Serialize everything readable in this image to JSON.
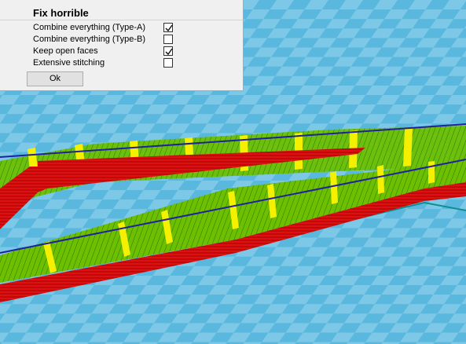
{
  "dialog": {
    "title": "Fix horrible",
    "options": [
      {
        "label": "Combine everything (Type-A)",
        "checked": true
      },
      {
        "label": "Combine everything (Type-B)",
        "checked": false
      },
      {
        "label": "Keep open faces",
        "checked": true
      },
      {
        "label": "Extensive stitching",
        "checked": false
      }
    ],
    "ok_label": "Ok"
  },
  "colors": {
    "floor_blue": "#5ab8de",
    "grid_light": "#7cc8e6",
    "wall_red": "#e01010",
    "infill_yellow": "#f4f000",
    "infill_green": "#7ed000",
    "outline_teal": "#0f8f8f",
    "edge_blue": "#2020a0"
  }
}
